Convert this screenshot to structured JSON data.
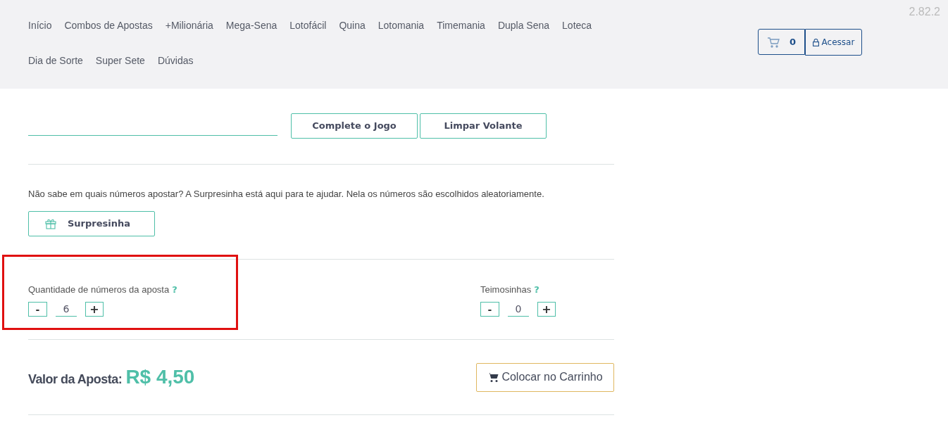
{
  "version": "2.82.2",
  "nav": {
    "items": [
      "Início",
      "Combos de Apostas",
      "+Milionária",
      "Mega-Sena",
      "Lotofácil",
      "Quina",
      "Lotomania",
      "Timemania",
      "Dupla Sena",
      "Loteca",
      "Dia de Sorte",
      "Super Sete",
      "Dúvidas"
    ]
  },
  "cart": {
    "count": "0",
    "login": "Acessar"
  },
  "actions": [
    "Complete o Jogo",
    "Limpar Volante"
  ],
  "surprise": {
    "text": "Não sabe em quais números apostar? A Surpresinha está aqui para te ajudar. Nela os números são escolhidos aleatoriamente.",
    "button": "Surpresinha"
  },
  "counters": [
    {
      "label": "Quantidade de números da aposta",
      "help": "?",
      "minus": "-",
      "value": "6",
      "plus": "+",
      "highlighted": true
    },
    {
      "label": "Teimosinhas",
      "help": "?",
      "minus": "-",
      "value": "0",
      "plus": "+",
      "highlighted": false
    }
  ],
  "total": {
    "label": "Valor da Aposta:",
    "value": "R$ 4,50",
    "button": "Colocar no Carrinho"
  }
}
